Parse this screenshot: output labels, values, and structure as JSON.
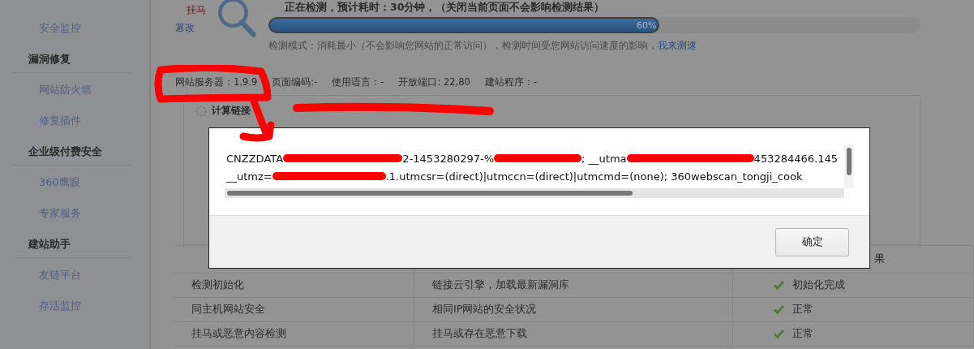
{
  "sidebar": {
    "items": [
      {
        "kind": "link",
        "label": "安全监控"
      },
      {
        "kind": "header",
        "label": "漏洞修复"
      },
      {
        "kind": "link",
        "label": "网站防火墙"
      },
      {
        "kind": "link",
        "label": "修复插件"
      },
      {
        "kind": "header",
        "label": "企业级付费安全"
      },
      {
        "kind": "link",
        "label": "360鹰眼"
      },
      {
        "kind": "link",
        "label": "专家服务"
      },
      {
        "kind": "header",
        "label": "建站助手"
      },
      {
        "kind": "link",
        "label": "友链平台"
      },
      {
        "kind": "link",
        "label": "存活监控"
      }
    ]
  },
  "logo": {
    "tag": "挂马",
    "caption": "篡改"
  },
  "scan": {
    "status": "正在检测，预计耗时：30分钟，（关闭当前页面不会影响检测结果）",
    "level": 0.6,
    "percent": "60%",
    "mode_text": "检测模式：消耗最小（不会影响您网站的正常访问），检测时间受您网站访问速度的影响，",
    "mode_link": "我来测速"
  },
  "site_info": [
    "网站服务器：1.9.9",
    "页面编码:-",
    "使用语言：-",
    "开放端口: 22,80",
    "建站程序：-"
  ],
  "task": {
    "label": "计算链接"
  },
  "dialog": {
    "lines": [
      [
        {
          "kind": "text",
          "text": "CNZZDATA"
        },
        {
          "kind": "redacted"
        },
        {
          "kind": "text",
          "text": "2-1453280297-%"
        },
        {
          "kind": "redacted"
        },
        {
          "kind": "text",
          "text": "; __utma"
        },
        {
          "kind": "redacted"
        },
        {
          "kind": "text",
          "text": "453284466.145"
        }
      ],
      [
        {
          "kind": "text",
          "text": "__utmz="
        },
        {
          "kind": "redacted"
        },
        {
          "kind": "text",
          "text": ".1.utmcsr=(direct)|utmccn=(direct)|utmcmd=(none); 360webscan_tongji_cook"
        }
      ]
    ],
    "button": "确定"
  },
  "table": {
    "column_3_header": "果",
    "rows": [
      {
        "item": "检测初始化",
        "description": "链接云引擎，加载最新漏洞库",
        "result": "初始化完成"
      },
      {
        "item": "同主机网站安全",
        "description": "相同IP网站的安全状况",
        "result": "正常"
      },
      {
        "item": "挂马或恶意内容检测",
        "description": "挂马或存在恶意下载",
        "result": "正常"
      }
    ]
  }
}
